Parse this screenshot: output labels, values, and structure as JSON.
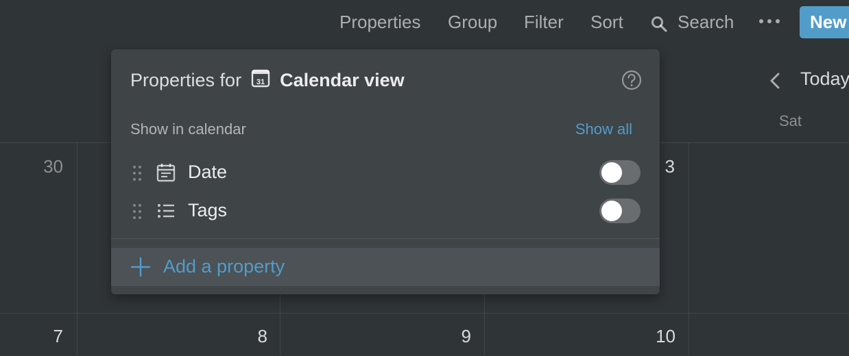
{
  "toolbar": {
    "properties": "Properties",
    "group": "Group",
    "filter": "Filter",
    "sort": "Sort",
    "search": "Search",
    "new": "New"
  },
  "calendar": {
    "today": "Today",
    "weekday_sat": "Sat",
    "days": {
      "row1_col1": "30",
      "row1_col4": "3",
      "row2_col1": "7",
      "row2_col2": "8",
      "row2_col3": "9",
      "row2_col4": "10"
    }
  },
  "popup": {
    "title_prefix": "Properties for",
    "view_icon_text": "31",
    "view_name": "Calendar view",
    "section_label": "Show in calendar",
    "show_all": "Show all",
    "properties": [
      {
        "label": "Date",
        "icon": "calendar-date-icon",
        "shown": false
      },
      {
        "label": "Tags",
        "icon": "list-icon",
        "shown": false
      }
    ],
    "add_property": "Add a property"
  },
  "colors": {
    "background": "#2f3437",
    "popup": "#3f4447",
    "accent": "#529cca"
  }
}
